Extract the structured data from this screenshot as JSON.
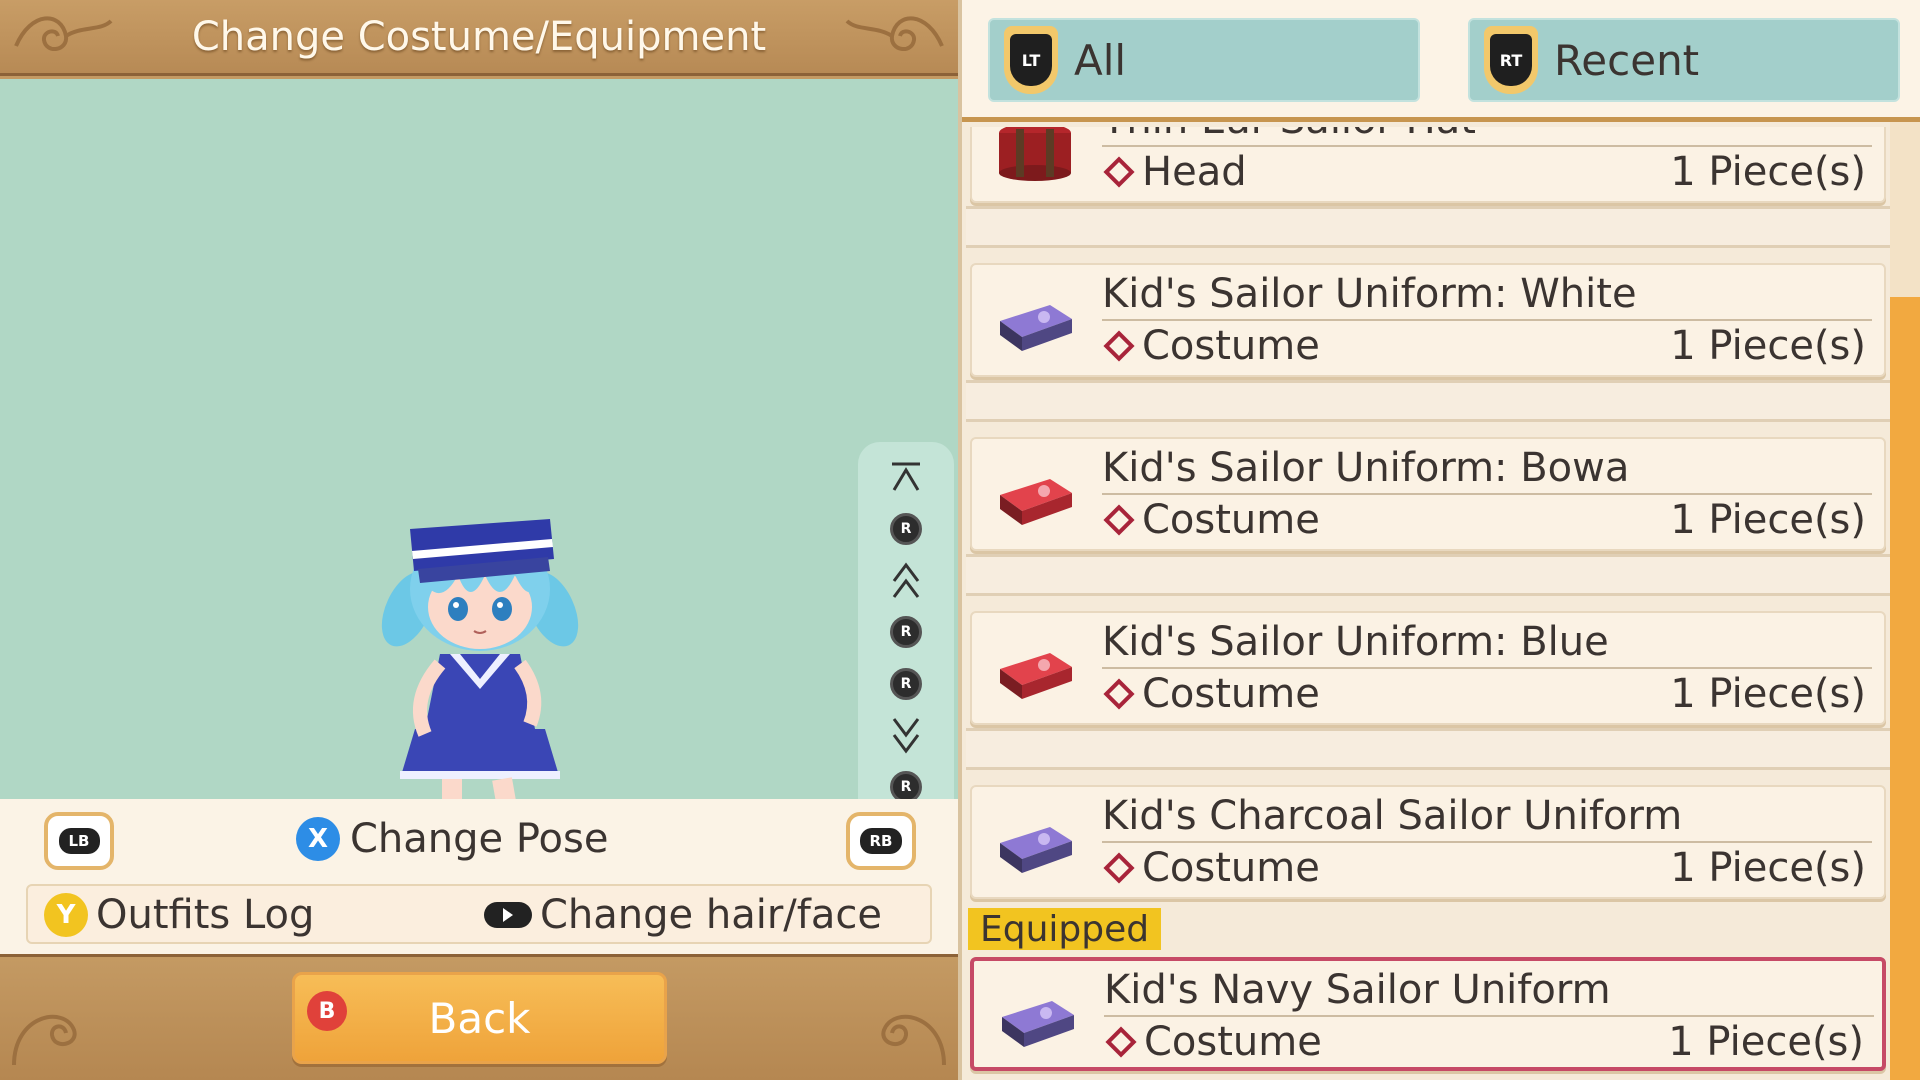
{
  "header": {
    "title": "Change Costume/Equipment"
  },
  "camera_controls": {
    "top_icon": "jump-top-icon",
    "r_stick_up": "R",
    "zoom_in_icon": "double-up-chevron-icon",
    "r_stick_left": "R",
    "r_stick_right": "R",
    "zoom_out_icon": "double-down-chevron-icon",
    "r_stick_down": "R",
    "bottom_icon": "jump-bottom-icon"
  },
  "controls": {
    "lb": "LB",
    "rb": "RB",
    "x_button": "X",
    "change_pose": "Change Pose",
    "y_button": "Y",
    "outfits_log": "Outfits Log",
    "change_hair_face": "Change hair/face"
  },
  "footer": {
    "b_button": "B",
    "back_label": "Back"
  },
  "tabs": [
    {
      "badge": "LT",
      "label": "All"
    },
    {
      "badge": "RT",
      "label": "Recent"
    }
  ],
  "items": [
    {
      "name": "Thin Ear Sailor Hat",
      "category": "Head",
      "qty": "1 Piece(s)",
      "icon": "red-hatbox-icon"
    },
    {
      "name": "Kid's Sailor Uniform: White",
      "category": "Costume",
      "qty": "1 Piece(s)",
      "icon": "purple-giftbox-icon"
    },
    {
      "name": "Kid's Sailor Uniform: Bowa",
      "category": "Costume",
      "qty": "1 Piece(s)",
      "icon": "red-giftbox-icon"
    },
    {
      "name": "Kid's Sailor Uniform: Blue",
      "category": "Costume",
      "qty": "1 Piece(s)",
      "icon": "red-giftbox-icon"
    },
    {
      "name": "Kid's Charcoal Sailor Uniform",
      "category": "Costume",
      "qty": "1 Piece(s)",
      "icon": "purple-giftbox-icon"
    },
    {
      "name": "Kid's Navy Sailor Uniform",
      "category": "Costume",
      "qty": "1 Piece(s)",
      "icon": "purple-giftbox-icon"
    }
  ],
  "equipped_label": "Equipped",
  "colors": {
    "accent_orange": "#efa33a",
    "tab_teal": "#a3cfcb",
    "preview_bg": "#b0d7c5",
    "equipped_border": "#c64a66",
    "equipped_tag": "#f2c420"
  }
}
